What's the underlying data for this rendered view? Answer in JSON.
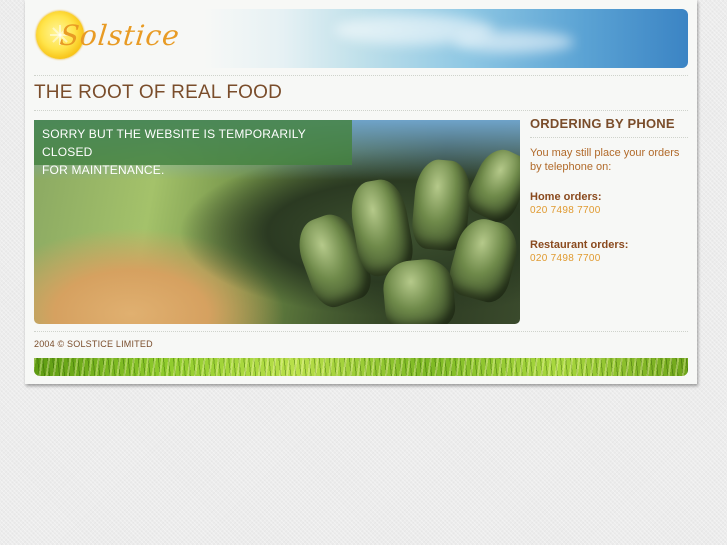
{
  "brand": {
    "logo_text": "Solstice",
    "tagline": "THE ROOT OF REAL FOOD"
  },
  "hero": {
    "notice_line1": "SORRY BUT THE WEBSITE IS TEMPORARILY CLOSED",
    "notice_line2": "FOR MAINTENANCE."
  },
  "sidebar": {
    "title": "ORDERING BY PHONE",
    "intro": "You may still place your orders by telephone on:",
    "orders": [
      {
        "label": "Home orders:",
        "phone": "020 7498 7700"
      },
      {
        "label": "Restaurant orders:",
        "phone": "020 7498 7700"
      }
    ]
  },
  "footer": {
    "copyright": "2004 © SOLSTICE LIMITED"
  },
  "colors": {
    "page_bg": "#f7f8f6",
    "heading_brown": "#7a4d2b",
    "phone_orange": "#e09a30",
    "notice_green": "#44823e"
  }
}
